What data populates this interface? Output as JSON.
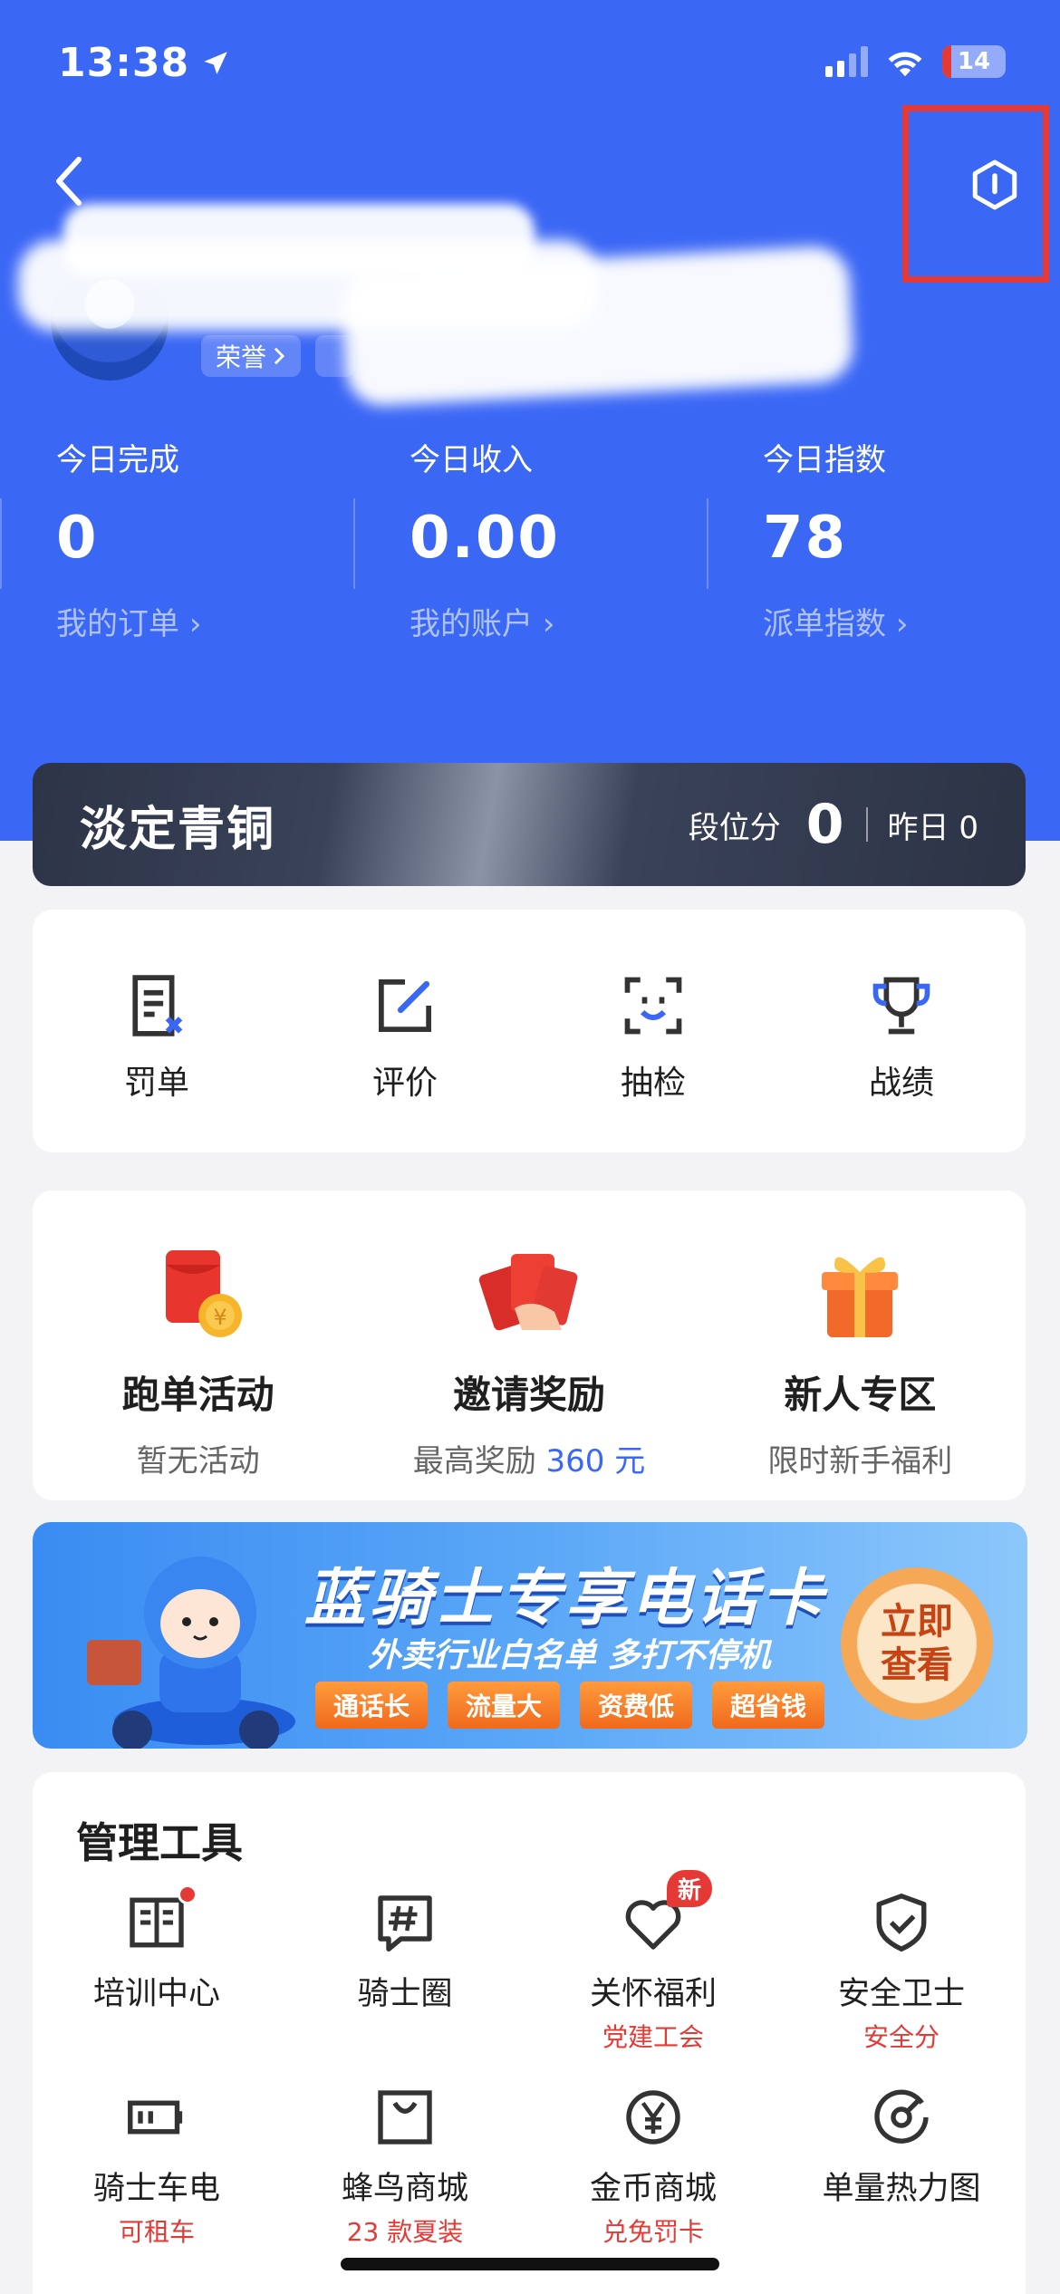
{
  "status_bar": {
    "time": "13:38",
    "battery": "14"
  },
  "rank": {
    "name": "淡定青铜",
    "score_label": "段位分",
    "score": "0",
    "yesterday": "昨日 0"
  },
  "profile": {
    "honor_tag": "荣誉"
  },
  "stats": [
    {
      "label": "今日完成",
      "value": "0",
      "link": "我的订单"
    },
    {
      "label": "今日收入",
      "value": "0.00",
      "link": "我的账户"
    },
    {
      "label": "今日指数",
      "value": "78",
      "link": "派单指数"
    }
  ],
  "quick_actions": [
    {
      "label": "罚单",
      "icon": "ticket-icon"
    },
    {
      "label": "评价",
      "icon": "edit-icon"
    },
    {
      "label": "抽检",
      "icon": "face-scan-icon"
    },
    {
      "label": "战绩",
      "icon": "trophy-icon"
    }
  ],
  "activities": [
    {
      "title": "跑单活动",
      "sub": "暂无活动"
    },
    {
      "title": "邀请奖励",
      "sub_prefix": "最高奖励 ",
      "sub_highlight": "360 元"
    },
    {
      "title": "新人专区",
      "sub": "限时新手福利"
    }
  ],
  "banner": {
    "title": "蓝骑士专享电话卡",
    "subtitle": "外卖行业白名单 多打不停机",
    "tags": [
      "通话长",
      "流量大",
      "资费低",
      "超省钱"
    ],
    "button": "立即查看"
  },
  "tools": {
    "title": "管理工具",
    "items": [
      {
        "label": "培训中心",
        "sub": "",
        "icon": "book-icon"
      },
      {
        "label": "骑士圈",
        "sub": "",
        "icon": "hash-chat-icon"
      },
      {
        "label": "关怀福利",
        "sub": "党建工会",
        "icon": "heart-icon",
        "badge": "新"
      },
      {
        "label": "安全卫士",
        "sub": "安全分",
        "icon": "shield-check-icon"
      },
      {
        "label": "骑士车电",
        "sub": "可租车",
        "icon": "battery-icon"
      },
      {
        "label": "蜂鸟商城",
        "sub": "23 款夏装",
        "icon": "shopping-bag-icon"
      },
      {
        "label": "金币商城",
        "sub": "兑免罚卡",
        "icon": "coin-yen-icon"
      },
      {
        "label": "单量热力图",
        "sub": "",
        "icon": "gauge-icon"
      }
    ]
  },
  "colors": {
    "primary": "#3b67f5",
    "accent_red": "#e53935"
  }
}
